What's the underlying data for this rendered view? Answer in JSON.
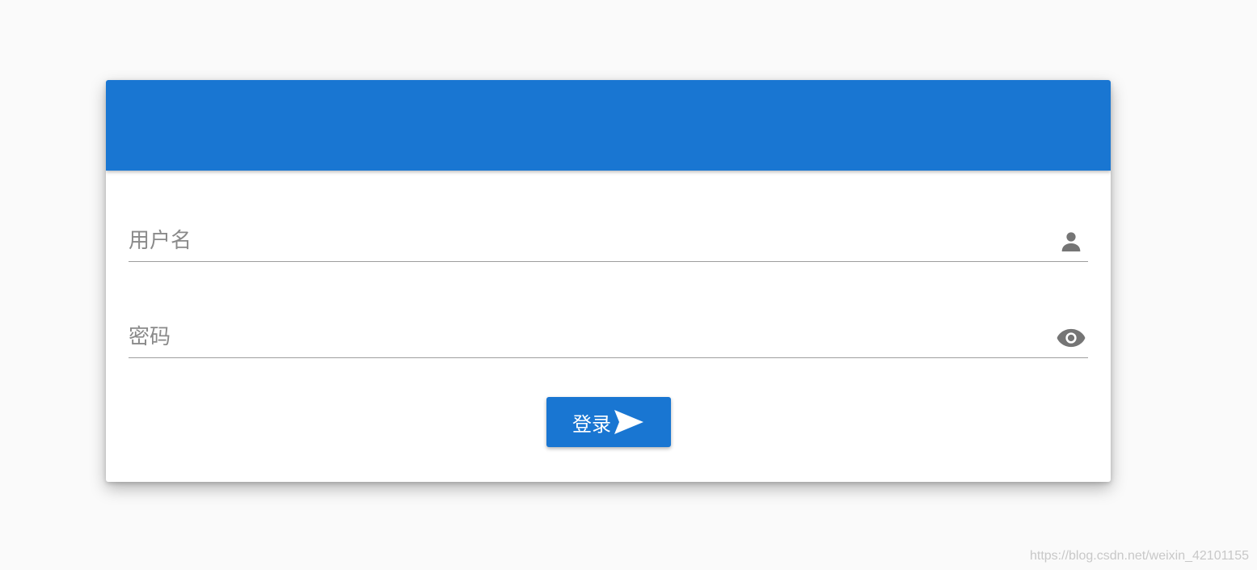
{
  "form": {
    "username": {
      "placeholder": "用户名",
      "value": "",
      "icon": "person-icon"
    },
    "password": {
      "placeholder": "密码",
      "value": "",
      "icon": "eye-icon"
    },
    "login_button": {
      "label": "登录",
      "icon": "send-icon"
    }
  },
  "watermark": "https://blog.csdn.net/weixin_42101155",
  "colors": {
    "primary": "#1976d2",
    "background": "#fafafa",
    "icon": "#757575",
    "divider": "#9e9e9e"
  }
}
